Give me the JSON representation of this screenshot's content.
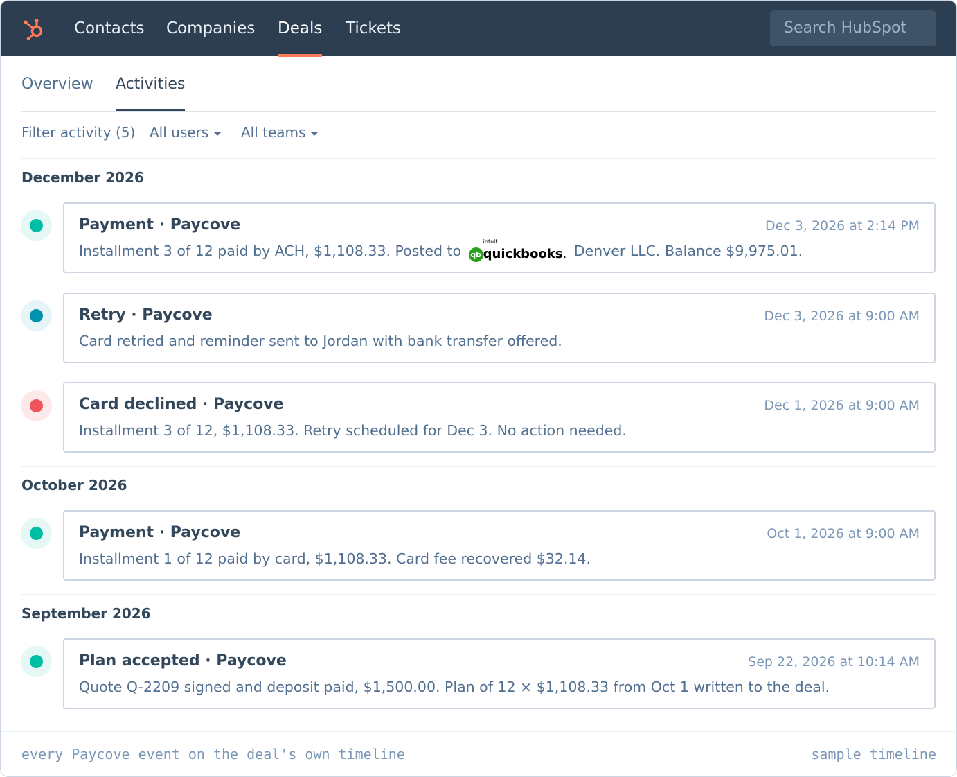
{
  "nav": {
    "logo_name": "hubspot-sprocket-icon",
    "items": [
      {
        "label": "Contacts",
        "active": false
      },
      {
        "label": "Companies",
        "active": false
      },
      {
        "label": "Deals",
        "active": true
      },
      {
        "label": "Tickets",
        "active": false
      }
    ],
    "search_placeholder": "Search HubSpot",
    "accent_color": "#ff7a59",
    "background_color": "#2d3e50"
  },
  "tabs": [
    {
      "label": "Overview",
      "active": false
    },
    {
      "label": "Activities",
      "active": true
    }
  ],
  "filters": {
    "activity": "Filter activity (5)",
    "users": "All users",
    "teams": "All teams"
  },
  "timeline": [
    {
      "month": "December 2026",
      "events": [
        {
          "title": "Payment · Paycove",
          "time": "Dec 3, 2026 at 2:14 PM",
          "status": "success",
          "dot_color": "#00bda5",
          "body_before": "Installment 3 of 12 paid by ACH, $1,108.33. Posted to",
          "logo": {
            "icon": "qb",
            "small": "intuit",
            "name": "quickbooks",
            "suffix": "."
          },
          "body_after": "Denver LLC. Balance $9,975.01."
        },
        {
          "title": "Retry · Paycove",
          "time": "Dec 3, 2026 at 9:00 AM",
          "status": "info",
          "dot_color": "#0091ae",
          "body": "Card retried and reminder sent to Jordan with bank transfer offered."
        },
        {
          "title": "Card declined · Paycove",
          "time": "Dec 1, 2026 at 9:00 AM",
          "status": "error",
          "dot_color": "#f2545b",
          "body": "Installment 3 of 12, $1,108.33. Retry scheduled for Dec 3. No action needed."
        }
      ]
    },
    {
      "month": "October 2026",
      "events": [
        {
          "title": "Payment · Paycove",
          "time": "Oct 1, 2026 at 9:00 AM",
          "status": "success",
          "dot_color": "#00bda5",
          "body": "Installment 1 of 12 paid by card, $1,108.33. Card fee recovered $32.14."
        }
      ]
    },
    {
      "month": "September 2026",
      "events": [
        {
          "title": "Plan accepted · Paycove",
          "time": "Sep 22, 2026 at 10:14 AM",
          "status": "success",
          "dot_color": "#00bda5",
          "body": "Quote Q-2209 signed and deposit paid, $1,500.00. Plan of 12 × $1,108.33 from Oct 1 written to the deal."
        }
      ]
    }
  ],
  "footer": {
    "left": "every Paycove event on the deal's own timeline",
    "right": "sample timeline"
  }
}
